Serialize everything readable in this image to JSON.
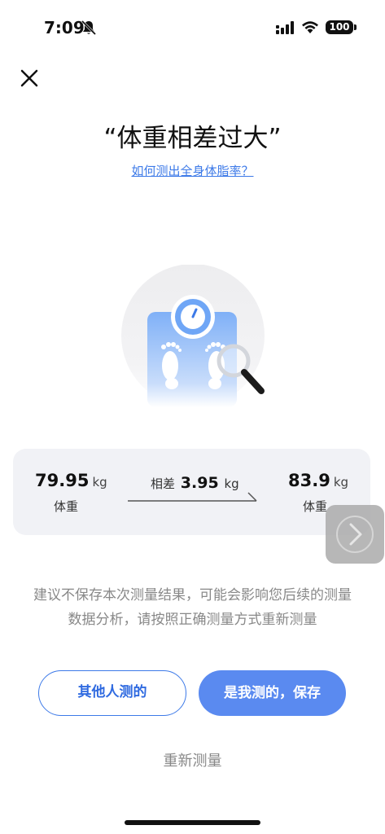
{
  "status": {
    "time": "7:09",
    "battery": "100"
  },
  "title": "“体重相差过大”",
  "help_link": "如何测出全身体脂率？",
  "comparison": {
    "left": {
      "value": "79.95",
      "unit": "kg",
      "label": "体重"
    },
    "diff": {
      "label": "相差",
      "value": "3.95",
      "unit": "kg"
    },
    "right": {
      "value": "83.9",
      "unit": "kg",
      "label": "体重"
    }
  },
  "advice": "建议不保存本次测量结果，可能会影响您后续的测量数据分析，请按照正确测量方式重新测量",
  "buttons": {
    "other": "其他人测的",
    "mine": "是我测的，保存",
    "remeasure": "重新测量"
  },
  "colors": {
    "accent": "#3d7ae8",
    "primary_button": "#5a8af0",
    "card_bg": "#f1f2f6"
  }
}
